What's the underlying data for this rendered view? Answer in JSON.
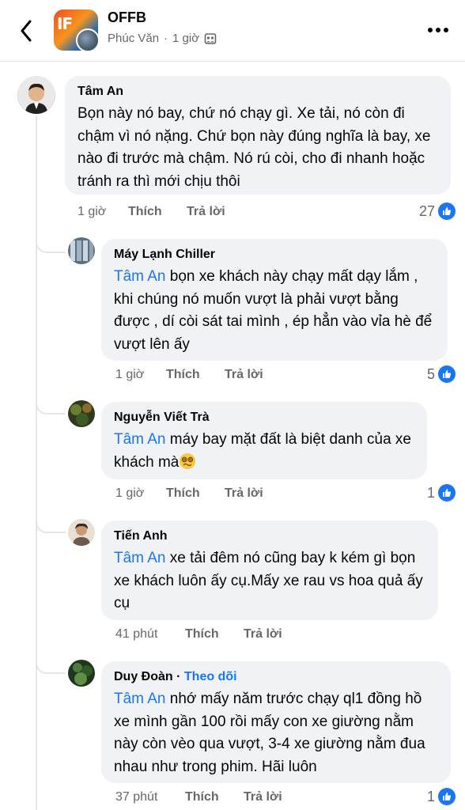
{
  "header": {
    "page_name": "OFFB",
    "logo_text": "IF",
    "author": "Phúc Văn",
    "time": "1 giờ",
    "separator": "·"
  },
  "comments": [
    {
      "author": "Tâm An",
      "mention": "",
      "text": "Bọn này nó bay, chứ nó chạy gì. Xe tải, nó còn đi chậm vì nó nặng. Chứ bọn này đúng nghĩa là bay, xe nào đi trước mà chậm. Nó rú còi, cho đi nhanh hoặc tránh ra thì mới chịu thôi",
      "time": "1 giờ",
      "like_label": "Thích",
      "reply_label": "Trả lời",
      "reactions": "27"
    },
    {
      "author": "Máy Lạnh Chiller",
      "mention": "Tâm An",
      "text": " bọn xe khách này chạy mất dạy lắm , khi chúng nó muốn vượt là phải vượt bằng được , dí còi sát tai mình , ép hẳn vào vỉa hè để vượt lên ấy",
      "time": "1 giờ",
      "like_label": "Thích",
      "reply_label": "Trả lời",
      "reactions": "5"
    },
    {
      "author": "Nguyễn Viết Trà",
      "mention": "Tâm An",
      "text": " máy bay mặt đất là biệt danh của xe khách mà",
      "emoji": "woozy-face-emoji",
      "time": "1 giờ",
      "like_label": "Thích",
      "reply_label": "Trả lời",
      "reactions": "1"
    },
    {
      "author": "Tiến Anh",
      "mention": "Tâm An",
      "text": " xe tải đêm nó cũng bay k kém gì bọn xe khách luôn ấy cụ.Mấy xe rau vs hoa quả ấy cụ",
      "time": "41 phút",
      "like_label": "Thích",
      "reply_label": "Trả lời",
      "reactions": ""
    },
    {
      "author": "Duy Đoàn",
      "dot": " · ",
      "follow": "Theo dõi",
      "mention": "Tâm An",
      "text": " nhớ mấy năm trước chạy ql1 đồng hồ xe mình gần 100 rồi mấy con xe giường nằm này còn vèo qua vượt,  3-4 xe giường nằm đua nhau như trong phim. Hãi luôn",
      "time": "37 phút",
      "like_label": "Thích",
      "reply_label": "Trả lời",
      "reactions": "1"
    }
  ],
  "colors": {
    "accent": "#1877f2",
    "bubble": "#f0f2f5",
    "secondary_text": "#65676b"
  }
}
